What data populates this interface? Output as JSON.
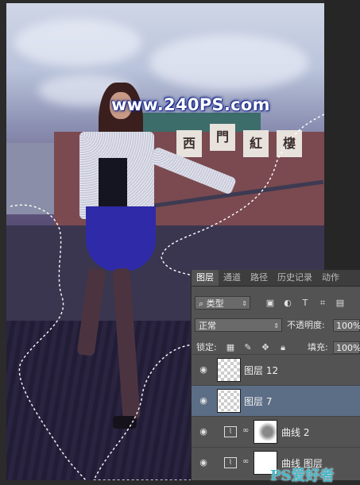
{
  "watermark": "www.240PS.com",
  "signs": [
    "西",
    "門",
    "紅",
    "樓"
  ],
  "panel": {
    "tabs": [
      "图层",
      "通道",
      "路径",
      "历史记录",
      "动作"
    ],
    "kind_label": "类型",
    "blend_mode": "正常",
    "opacity_label": "不透明度:",
    "opacity_value": "100%",
    "lock_label": "锁定:",
    "fill_label": "填充:",
    "fill_value": "100%",
    "layers": [
      {
        "name": "图层 12",
        "type": "pixel",
        "selected": false
      },
      {
        "name": "图层 7",
        "type": "pixel",
        "selected": true
      },
      {
        "name": "曲线 2",
        "type": "curves",
        "selected": false
      },
      {
        "name": "曲线 图层",
        "type": "curves",
        "selected": false
      }
    ]
  },
  "site_logo": "PS爱好者",
  "colors": {
    "selection_highlight": "#5c6d86",
    "panel_bg": "#535353",
    "watermark_outline": "#1a2a8a"
  }
}
